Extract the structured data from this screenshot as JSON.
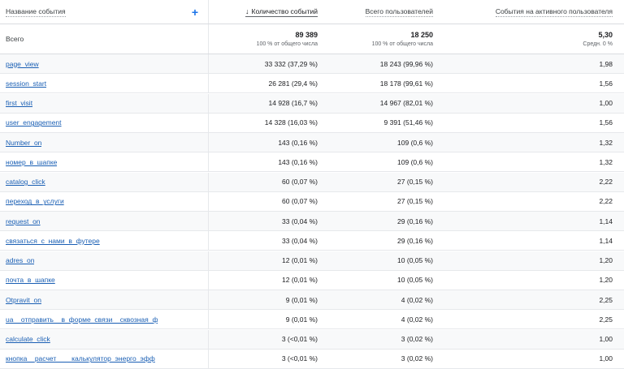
{
  "header": {
    "event_name": "Название события",
    "add_icon": "+",
    "sort_arrow": "↓",
    "event_count": "Количество событий",
    "total_users": "Всего пользователей",
    "events_per_user": "События на активного пользователя"
  },
  "totals": {
    "label": "Всего",
    "event_count": "89 389",
    "event_count_sub": "100 % от общего числа",
    "total_users": "18 250",
    "total_users_sub": "100 % от общего числа",
    "events_per_user": "5,30",
    "events_per_user_sub": "Средн. 0 %"
  },
  "rows": [
    {
      "name": "page_view",
      "count": "33 332 (37,29 %)",
      "users": "18 243 (99,96 %)",
      "per_user": "1,98"
    },
    {
      "name": "session_start",
      "count": "26 281 (29,4 %)",
      "users": "18 178 (99,61 %)",
      "per_user": "1,56"
    },
    {
      "name": "first_visit",
      "count": "14 928 (16,7 %)",
      "users": "14 967 (82,01 %)",
      "per_user": "1,00"
    },
    {
      "name": "user_engagement",
      "count": "14 328 (16,03 %)",
      "users": "9 391 (51,46 %)",
      "per_user": "1,56"
    },
    {
      "name": "Number_on",
      "count": "143 (0,16 %)",
      "users": "109 (0,6 %)",
      "per_user": "1,32"
    },
    {
      "name": "номер_в_шапке",
      "count": "143 (0,16 %)",
      "users": "109 (0,6 %)",
      "per_user": "1,32"
    },
    {
      "name": "catalog_click",
      "count": "60 (0,07 %)",
      "users": "27 (0,15 %)",
      "per_user": "2,22"
    },
    {
      "name": "переход_в_услуги",
      "count": "60 (0,07 %)",
      "users": "27 (0,15 %)",
      "per_user": "2,22"
    },
    {
      "name": "request_on",
      "count": "33 (0,04 %)",
      "users": "29 (0,16 %)",
      "per_user": "1,14"
    },
    {
      "name": "связаться_с_нами_в_футере",
      "count": "33 (0,04 %)",
      "users": "29 (0,16 %)",
      "per_user": "1,14"
    },
    {
      "name": "adres_on",
      "count": "12 (0,01 %)",
      "users": "10 (0,05 %)",
      "per_user": "1,20"
    },
    {
      "name": "почта_в_шапке",
      "count": "12 (0,01 %)",
      "users": "10 (0,05 %)",
      "per_user": "1,20"
    },
    {
      "name": "Otpravit_on",
      "count": "9 (0,01 %)",
      "users": "4 (0,02 %)",
      "per_user": "2,25"
    },
    {
      "name": "ua__отправить__в_форме_связи__сквозная_ф",
      "count": "9 (0,01 %)",
      "users": "4 (0,02 %)",
      "per_user": "2,25"
    },
    {
      "name": "calculate_click",
      "count": "3 (<0,01 %)",
      "users": "3 (0,02 %)",
      "per_user": "1,00"
    },
    {
      "name": "кнопка__расчет____калькулятор_энерго_эфф",
      "count": "3 (<0,01 %)",
      "users": "3 (0,02 %)",
      "per_user": "1,00"
    }
  ]
}
